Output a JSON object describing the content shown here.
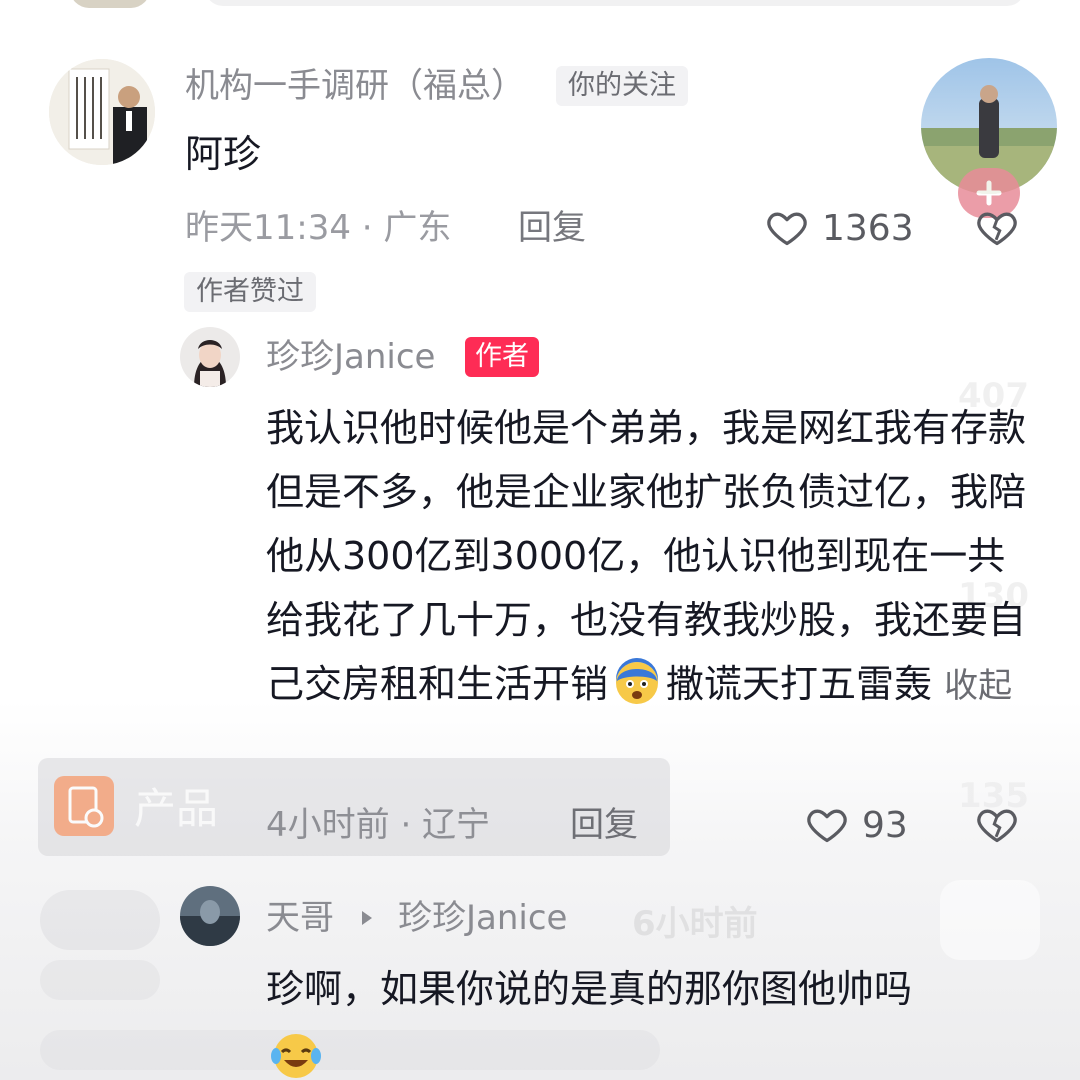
{
  "comment1": {
    "username": "机构一手调研（福总）",
    "follow_tag": "你的关注",
    "text": "阿珍",
    "time_location": "昨天11:34 · 广东",
    "reply_label": "回复",
    "likes": "1363",
    "author_liked_tag": "作者赞过"
  },
  "reply1": {
    "username": "珍珍Janice",
    "author_tag": "作者",
    "text": "我认识他时候他是个弟弟，我是网红我有存款但是不多，他是企业家他扩张负债过亿，我陪他从300亿到3000亿，他认识他到现在一共给我花了几十万，也没有教我炒股，我还要自己交房租和生活开销",
    "text_after_emoji": "撒谎天打五雷轰",
    "collapse_label": "收起",
    "time_location": "4小时前 · 辽宁",
    "reply_label": "回复",
    "likes": "93"
  },
  "reply2": {
    "username": "天哥",
    "reply_to": "珍珍Janice",
    "text": "珍啊，如果你说的是真的那你图他帅吗"
  },
  "overlay": {
    "product_label": "产品",
    "ghost_count_1": "407",
    "ghost_count_2": "130",
    "ghost_count_3": "135",
    "ghost_time": "6小时前"
  }
}
